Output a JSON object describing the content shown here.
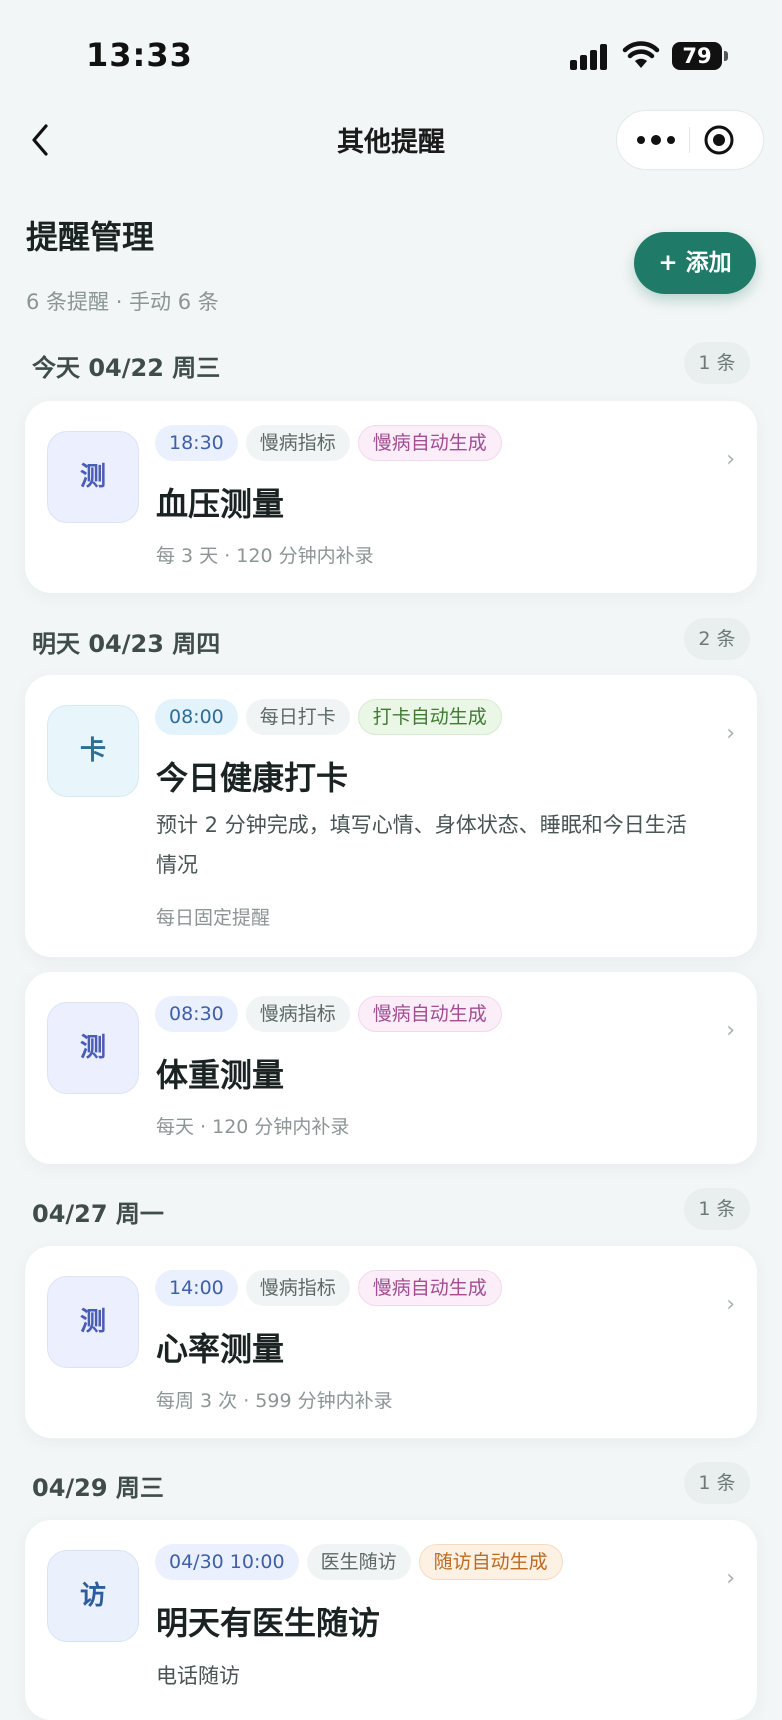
{
  "status_bar": {
    "time": "13:33",
    "battery": "79"
  },
  "nav": {
    "title": "其他提醒"
  },
  "header": {
    "title": "提醒管理",
    "summary": "6 条提醒 · 手动 6 条",
    "add_label": "+ 添加"
  },
  "sections": [
    {
      "date": "今天 04/22 周三",
      "count": "1 条",
      "cards": [
        {
          "icon": "测",
          "time": "18:30",
          "category": "慢病指标",
          "auto_tag": "慢病自动生成",
          "title": "血压测量",
          "meta": "每 3 天 · 120 分钟内补录"
        }
      ]
    },
    {
      "date": "明天 04/23 周四",
      "count": "2 条",
      "cards": [
        {
          "icon": "卡",
          "time": "08:00",
          "category": "每日打卡",
          "auto_tag": "打卡自动生成",
          "title": "今日健康打卡",
          "desc": "预计 2 分钟完成，填写心情、身体状态、睡眠和今日生活情况",
          "meta": "每日固定提醒"
        },
        {
          "icon": "测",
          "time": "08:30",
          "category": "慢病指标",
          "auto_tag": "慢病自动生成",
          "title": "体重测量",
          "meta": "每天 · 120 分钟内补录"
        }
      ]
    },
    {
      "date": "04/27 周一",
      "count": "1 条",
      "cards": [
        {
          "icon": "测",
          "time": "14:00",
          "category": "慢病指标",
          "auto_tag": "慢病自动生成",
          "title": "心率测量",
          "meta": "每周 3 次 · 599 分钟内补录"
        }
      ]
    },
    {
      "date": "04/29 周三",
      "count": "1 条",
      "cards": [
        {
          "icon": "访",
          "time": "04/30 10:00",
          "category": "医生随访",
          "auto_tag": "随访自动生成",
          "title": "明天有医生随访",
          "meta": "电话随访"
        }
      ]
    }
  ],
  "colors": {
    "accent": "#1f7a68",
    "background": "#f3f6f6",
    "tag_pink": "#a34d94",
    "tag_green": "#427a35",
    "tag_orange": "#bd6b22"
  },
  "icons": {
    "back": "chevron-left-icon",
    "more": "more-dots-icon",
    "close": "target-circle-icon",
    "chevron": "chevron-right-icon"
  }
}
